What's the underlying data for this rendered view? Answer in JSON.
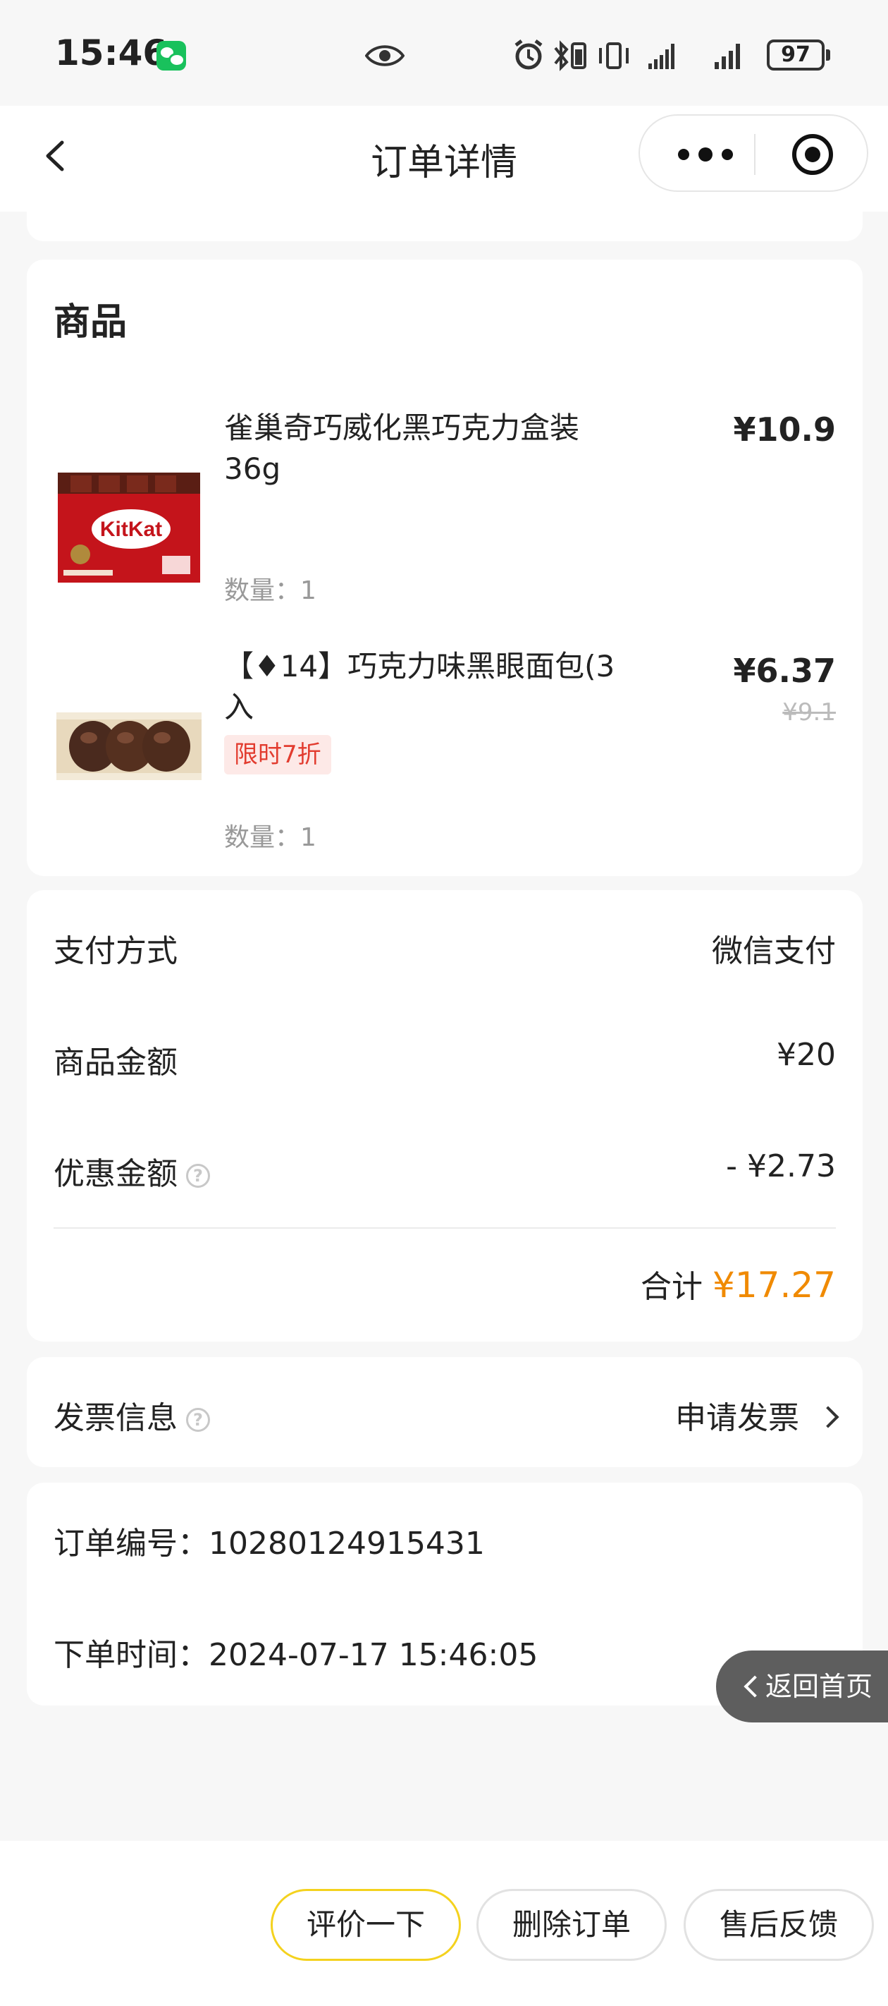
{
  "status_bar": {
    "time": "15:46",
    "battery": "97"
  },
  "nav": {
    "title": "订单详情"
  },
  "products": {
    "section_title": "商品",
    "items": [
      {
        "name": "雀巢奇巧威化黑巧克力盒装36g",
        "price": "¥10.9",
        "quantity": "数量：1",
        "image_icon": "kitkat-box-image"
      },
      {
        "name": "【♦14】巧克力味黑眼面包(3入",
        "price": "¥6.37",
        "original_price": "¥9.1",
        "badge": "限时7折",
        "quantity": "数量：1",
        "image_icon": "chocolate-bread-image"
      }
    ]
  },
  "payment": {
    "method_label": "支付方式",
    "method_value": "微信支付",
    "goods_amount_label": "商品金额",
    "goods_amount_value": "¥20",
    "discount_label": "优惠金额",
    "discount_value": "- ¥2.73",
    "total_label": "合计",
    "total_value": "¥17.27"
  },
  "invoice": {
    "label": "发票信息",
    "action": "申请发票"
  },
  "order": {
    "number_label": "订单编号：",
    "number_value": "10280124915431",
    "time_label": "下单时间：",
    "time_value": "2024-07-17 15:46:05"
  },
  "floating": {
    "back_home": "返回首页"
  },
  "actions": {
    "review": "评价一下",
    "delete": "删除订单",
    "after_sales": "售后反馈"
  },
  "colors": {
    "accent_orange": "#f08a00",
    "primary_button_border": "#f4d21e",
    "badge_red": "#e23c2f"
  }
}
